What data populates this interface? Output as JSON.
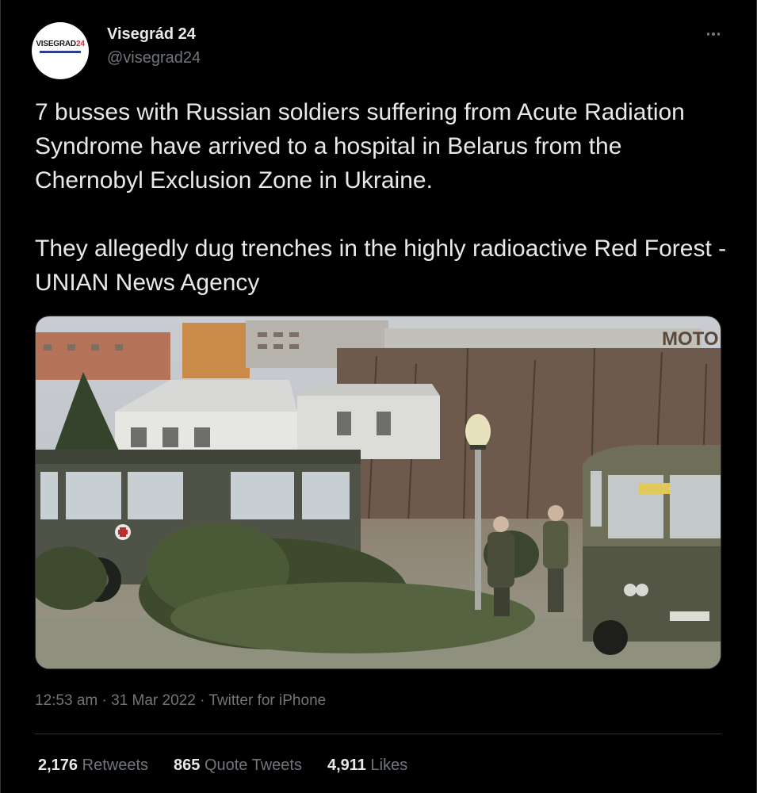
{
  "author": {
    "display_name": "Visegrád 24",
    "handle": "@visegrad24",
    "avatar_text_main": "VISEGRAD",
    "avatar_text_accent": "24"
  },
  "tweet": {
    "text": "7 busses with Russian soldiers suffering from Acute Radiation Syndrome have arrived to a hospital in Belarus from the Chernobyl Exclusion Zone in Ukraine.\n\nThey allegedly dug trenches in the highly radioactive Red Forest - UNIAN News Agency",
    "watermark": "MOTO"
  },
  "meta": {
    "time": "12:53 am",
    "date": "31 Mar 2022",
    "source": "Twitter for iPhone",
    "separator": "·"
  },
  "stats": [
    {
      "count": "2,176",
      "label": "Retweets"
    },
    {
      "count": "865",
      "label": "Quote Tweets"
    },
    {
      "count": "4,911",
      "label": "Likes"
    }
  ],
  "colors": {
    "background": "#000000",
    "text": "#e7e9ea",
    "muted": "#71767b",
    "border": "#2f3336"
  }
}
